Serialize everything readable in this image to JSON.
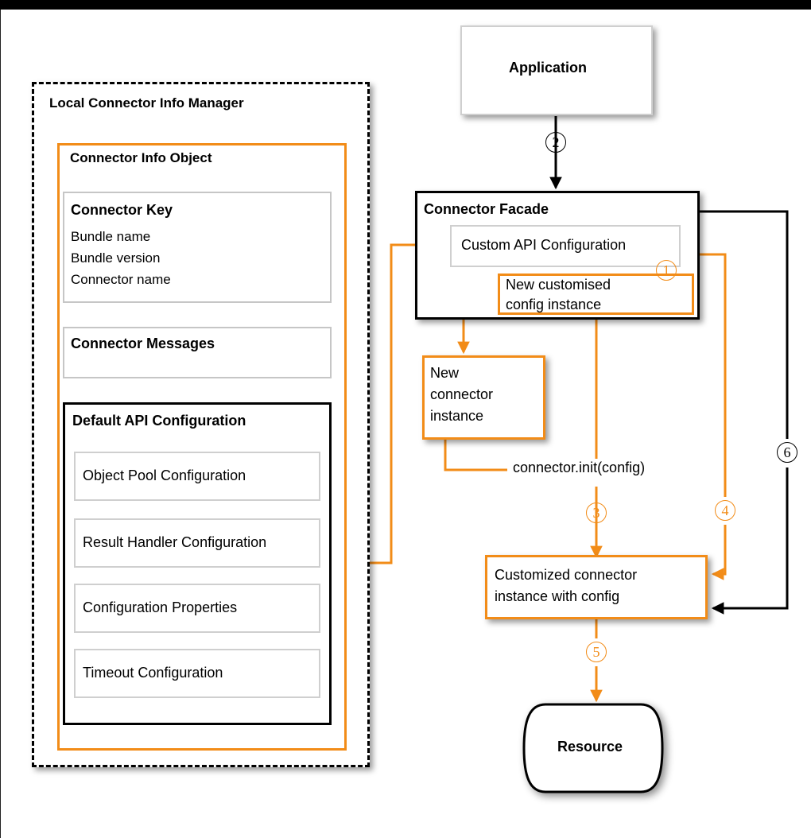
{
  "diagram": {
    "title_bar": "",
    "colors": {
      "accent_orange": "#F28C18",
      "black": "#000000",
      "grey_border": "#c6c6c6"
    },
    "left_panel": {
      "manager_title": "Local Connector Info Manager",
      "info_object_title": "Connector Info Object",
      "connector_key": {
        "title": "Connector Key",
        "lines": [
          "Bundle name",
          "Bundle version",
          "Connector name"
        ]
      },
      "connector_messages_title": "Connector Messages",
      "default_api_config": {
        "title": "Default API Configuration",
        "items": [
          "Object Pool Configuration",
          "Result Handler Configuration",
          "Configuration Properties",
          "Timeout Configuration"
        ]
      }
    },
    "right_panel": {
      "application": "Application",
      "connector_facade_title": "Connector Facade",
      "custom_api_configuration": "Custom API Configuration",
      "new_customised_config_instance": "New customised\nconfig instance",
      "new_connector_instance": "New\nconnector\ninstance",
      "connector_init_label": "connector.init(config)",
      "customized_connector_instance": "Customized connector\ninstance with config",
      "resource": "Resource"
    },
    "steps": [
      {
        "id": "1",
        "glyph": "①",
        "color": "orange"
      },
      {
        "id": "2",
        "glyph": "②",
        "color": "black"
      },
      {
        "id": "3",
        "glyph": "③",
        "color": "orange"
      },
      {
        "id": "4",
        "glyph": "④",
        "color": "orange"
      },
      {
        "id": "5",
        "glyph": "⑤",
        "color": "orange"
      },
      {
        "id": "6",
        "glyph": "⑥",
        "color": "black"
      }
    ]
  }
}
